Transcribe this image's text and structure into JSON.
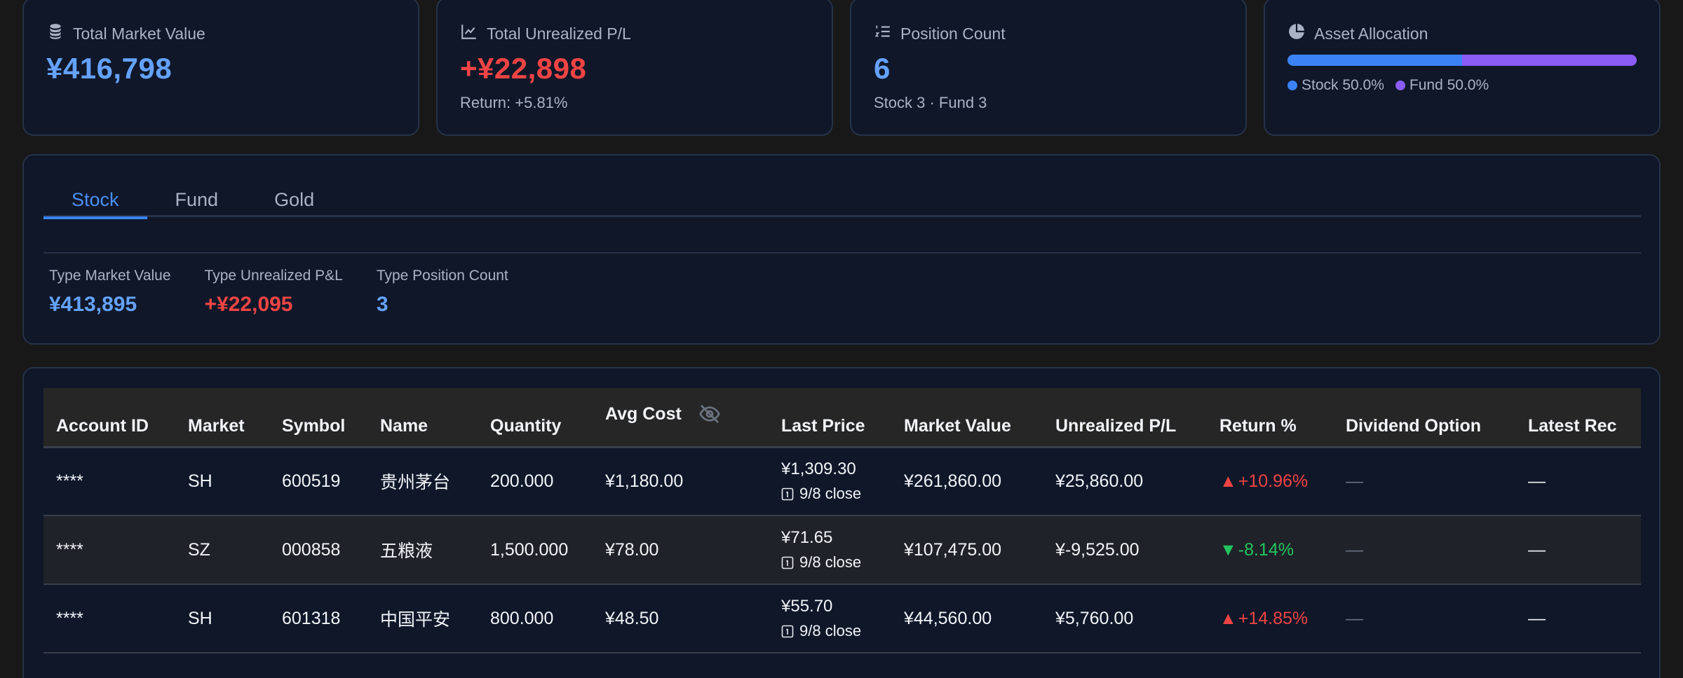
{
  "summary": {
    "total_market_value": {
      "label": "Total Market Value",
      "value": "¥416,798",
      "icon": "coins-icon"
    },
    "total_unrealized": {
      "label": "Total Unrealized P/L",
      "value": "+¥22,898",
      "sub": "Return: +5.81%",
      "icon": "line-chart-icon"
    },
    "position_count": {
      "label": "Position Count",
      "value": "6",
      "sub": "Stock 3 · Fund 3",
      "icon": "numbered-list-icon"
    },
    "asset_allocation": {
      "label": "Asset Allocation",
      "icon": "pie-chart-icon",
      "stock_fraction": 0.5,
      "fund_fraction": 0.5,
      "stock_legend": "Stock 50.0%",
      "fund_legend": "Fund 50.0%",
      "stock_color": "#3b82f6",
      "fund_color": "#8b5cf6"
    }
  },
  "tabs": [
    {
      "label": "Stock",
      "active": true
    },
    {
      "label": "Fund",
      "active": false
    },
    {
      "label": "Gold",
      "active": false
    }
  ],
  "type_stats": {
    "market_value": {
      "label": "Type Market Value",
      "value": "¥413,895"
    },
    "unrealized": {
      "label": "Type Unrealized P&L",
      "value": "+¥22,095"
    },
    "position_count": {
      "label": "Type Position Count",
      "value": "3"
    }
  },
  "table": {
    "headers": {
      "account_id": "Account ID",
      "market": "Market",
      "symbol": "Symbol",
      "name": "Name",
      "quantity": "Quantity",
      "avg_cost": "Avg Cost",
      "last_price": "Last Price",
      "market_value": "Market Value",
      "unrealized": "Unrealized P/L",
      "return_pct": "Return %",
      "dividend_option": "Dividend Option",
      "latest_rec": "Latest Rec"
    },
    "rows": [
      {
        "account_id": "****",
        "market": "SH",
        "symbol": "600519",
        "name": "贵州茅台",
        "quantity": "200.000",
        "avg_cost": "¥1,180.00",
        "last_price": "¥1,309.30",
        "price_note": "9/8 close",
        "market_value": "¥261,860.00",
        "unrealized": "¥25,860.00",
        "return_arrow": "▲",
        "return_pct": "+10.96%",
        "direction": "up",
        "dividend_option": "—",
        "latest_rec": "—"
      },
      {
        "account_id": "****",
        "market": "SZ",
        "symbol": "000858",
        "name": "五粮液",
        "quantity": "1,500.000",
        "avg_cost": "¥78.00",
        "last_price": "¥71.65",
        "price_note": "9/8 close",
        "market_value": "¥107,475.00",
        "unrealized": "¥-9,525.00",
        "return_arrow": "▼",
        "return_pct": "-8.14%",
        "direction": "down",
        "dividend_option": "—",
        "latest_rec": "—"
      },
      {
        "account_id": "****",
        "market": "SH",
        "symbol": "601318",
        "name": "中国平安",
        "quantity": "800.000",
        "avg_cost": "¥48.50",
        "last_price": "¥55.70",
        "price_note": "9/8 close",
        "market_value": "¥44,560.00",
        "unrealized": "¥5,760.00",
        "return_arrow": "▲",
        "return_pct": "+14.85%",
        "direction": "up",
        "dividend_option": "—",
        "latest_rec": "—"
      }
    ]
  },
  "colors": {
    "accent_blue": "#64a2fb",
    "gain_red": "#ef4444",
    "loss_green": "#22c55e"
  }
}
